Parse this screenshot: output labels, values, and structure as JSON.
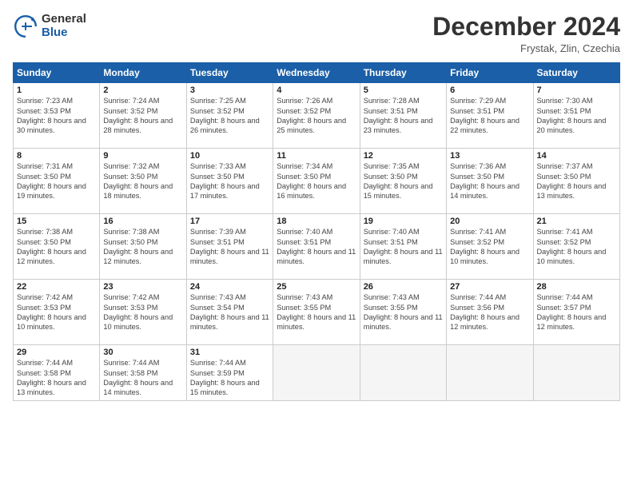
{
  "header": {
    "logo_general": "General",
    "logo_blue": "Blue",
    "title": "December 2024",
    "location": "Frystak, Zlin, Czechia"
  },
  "weekdays": [
    "Sunday",
    "Monday",
    "Tuesday",
    "Wednesday",
    "Thursday",
    "Friday",
    "Saturday"
  ],
  "weeks": [
    [
      {
        "day": 1,
        "sunrise": "7:23 AM",
        "sunset": "3:53 PM",
        "daylight": "8 hours and 30 minutes."
      },
      {
        "day": 2,
        "sunrise": "7:24 AM",
        "sunset": "3:52 PM",
        "daylight": "8 hours and 28 minutes."
      },
      {
        "day": 3,
        "sunrise": "7:25 AM",
        "sunset": "3:52 PM",
        "daylight": "8 hours and 26 minutes."
      },
      {
        "day": 4,
        "sunrise": "7:26 AM",
        "sunset": "3:52 PM",
        "daylight": "8 hours and 25 minutes."
      },
      {
        "day": 5,
        "sunrise": "7:28 AM",
        "sunset": "3:51 PM",
        "daylight": "8 hours and 23 minutes."
      },
      {
        "day": 6,
        "sunrise": "7:29 AM",
        "sunset": "3:51 PM",
        "daylight": "8 hours and 22 minutes."
      },
      {
        "day": 7,
        "sunrise": "7:30 AM",
        "sunset": "3:51 PM",
        "daylight": "8 hours and 20 minutes."
      }
    ],
    [
      {
        "day": 8,
        "sunrise": "7:31 AM",
        "sunset": "3:50 PM",
        "daylight": "8 hours and 19 minutes."
      },
      {
        "day": 9,
        "sunrise": "7:32 AM",
        "sunset": "3:50 PM",
        "daylight": "8 hours and 18 minutes."
      },
      {
        "day": 10,
        "sunrise": "7:33 AM",
        "sunset": "3:50 PM",
        "daylight": "8 hours and 17 minutes."
      },
      {
        "day": 11,
        "sunrise": "7:34 AM",
        "sunset": "3:50 PM",
        "daylight": "8 hours and 16 minutes."
      },
      {
        "day": 12,
        "sunrise": "7:35 AM",
        "sunset": "3:50 PM",
        "daylight": "8 hours and 15 minutes."
      },
      {
        "day": 13,
        "sunrise": "7:36 AM",
        "sunset": "3:50 PM",
        "daylight": "8 hours and 14 minutes."
      },
      {
        "day": 14,
        "sunrise": "7:37 AM",
        "sunset": "3:50 PM",
        "daylight": "8 hours and 13 minutes."
      }
    ],
    [
      {
        "day": 15,
        "sunrise": "7:38 AM",
        "sunset": "3:50 PM",
        "daylight": "8 hours and 12 minutes."
      },
      {
        "day": 16,
        "sunrise": "7:38 AM",
        "sunset": "3:50 PM",
        "daylight": "8 hours and 12 minutes."
      },
      {
        "day": 17,
        "sunrise": "7:39 AM",
        "sunset": "3:51 PM",
        "daylight": "8 hours and 11 minutes."
      },
      {
        "day": 18,
        "sunrise": "7:40 AM",
        "sunset": "3:51 PM",
        "daylight": "8 hours and 11 minutes."
      },
      {
        "day": 19,
        "sunrise": "7:40 AM",
        "sunset": "3:51 PM",
        "daylight": "8 hours and 11 minutes."
      },
      {
        "day": 20,
        "sunrise": "7:41 AM",
        "sunset": "3:52 PM",
        "daylight": "8 hours and 10 minutes."
      },
      {
        "day": 21,
        "sunrise": "7:41 AM",
        "sunset": "3:52 PM",
        "daylight": "8 hours and 10 minutes."
      }
    ],
    [
      {
        "day": 22,
        "sunrise": "7:42 AM",
        "sunset": "3:53 PM",
        "daylight": "8 hours and 10 minutes."
      },
      {
        "day": 23,
        "sunrise": "7:42 AM",
        "sunset": "3:53 PM",
        "daylight": "8 hours and 10 minutes."
      },
      {
        "day": 24,
        "sunrise": "7:43 AM",
        "sunset": "3:54 PM",
        "daylight": "8 hours and 11 minutes."
      },
      {
        "day": 25,
        "sunrise": "7:43 AM",
        "sunset": "3:55 PM",
        "daylight": "8 hours and 11 minutes."
      },
      {
        "day": 26,
        "sunrise": "7:43 AM",
        "sunset": "3:55 PM",
        "daylight": "8 hours and 11 minutes."
      },
      {
        "day": 27,
        "sunrise": "7:44 AM",
        "sunset": "3:56 PM",
        "daylight": "8 hours and 12 minutes."
      },
      {
        "day": 28,
        "sunrise": "7:44 AM",
        "sunset": "3:57 PM",
        "daylight": "8 hours and 12 minutes."
      }
    ],
    [
      {
        "day": 29,
        "sunrise": "7:44 AM",
        "sunset": "3:58 PM",
        "daylight": "8 hours and 13 minutes."
      },
      {
        "day": 30,
        "sunrise": "7:44 AM",
        "sunset": "3:58 PM",
        "daylight": "8 hours and 14 minutes."
      },
      {
        "day": 31,
        "sunrise": "7:44 AM",
        "sunset": "3:59 PM",
        "daylight": "8 hours and 15 minutes."
      },
      null,
      null,
      null,
      null
    ]
  ],
  "labels": {
    "sunrise": "Sunrise:",
    "sunset": "Sunset:",
    "daylight": "Daylight:"
  }
}
